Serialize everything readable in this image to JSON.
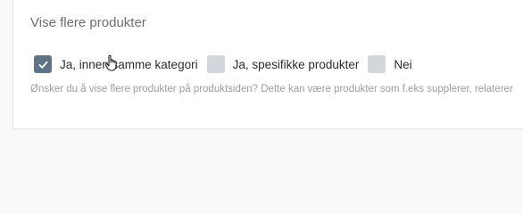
{
  "section": {
    "title": "Vise flere produkter",
    "help_text": "Ønsker du å vise flere produkter på produktsiden? Dette kan være produkter som f.eks supplerer, relaterer"
  },
  "options": [
    {
      "label": "Ja, innen samme kategori",
      "checked": true
    },
    {
      "label": "Ja, spesifikke produkter",
      "checked": false
    },
    {
      "label": "Nei",
      "checked": false
    }
  ],
  "colors": {
    "checked_box": "#5e7384",
    "unchecked_box": "#d3d7db",
    "title_text": "#6b6f74",
    "help_text": "#9aa0a6"
  }
}
